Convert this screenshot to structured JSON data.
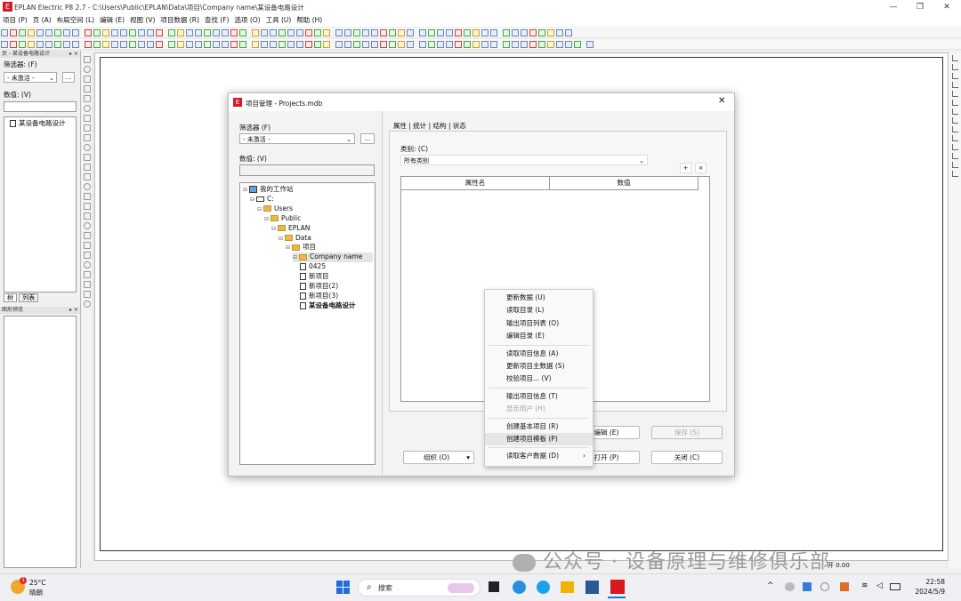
{
  "window": {
    "title": "EPLAN Electric P8 2.7 - C:\\Users\\Public\\EPLAN\\Data\\项目\\Company name\\某设备电路设计",
    "logo_text": "E",
    "min_glyph": "—",
    "restore_glyph": "❐",
    "close_glyph": "✕"
  },
  "menubar": [
    "项目 (P)",
    "页 (A)",
    "布局空间 (L)",
    "编辑 (E)",
    "视图 (V)",
    "项目数据 (R)",
    "查找 (F)",
    "选项 (O)",
    "工具 (U)",
    "帮助 (H)"
  ],
  "left_panel": {
    "header": "页 - 某设备电路设计",
    "pin": "▸ ×",
    "filter_label": "筛选器: (F)",
    "filter_value": "- 未激活 -",
    "filter_btn": "...",
    "value_label": "数值: (V)",
    "tree_item": "某设备电路设计",
    "tabs": [
      "树",
      "列表"
    ],
    "bottom_header": "图形预览",
    "bottom_pin": "▸ ×"
  },
  "dialog": {
    "title": "项目管理 - Projects.mdb",
    "logo_text": "E",
    "close_glyph": "✕",
    "filter_label": "筛选器 (F)",
    "filter_value": "- 未激活 -",
    "filter_btn": "...",
    "value_label": "数值: (V)",
    "tree": [
      {
        "text": "我的工作站",
        "level": 0,
        "type": "pc"
      },
      {
        "text": "C:",
        "level": 1,
        "type": "drive"
      },
      {
        "text": "Users",
        "level": 2,
        "type": "folder"
      },
      {
        "text": "Public",
        "level": 3,
        "type": "folder"
      },
      {
        "text": "EPLAN",
        "level": 4,
        "type": "folder"
      },
      {
        "text": "Data",
        "level": 5,
        "type": "folder"
      },
      {
        "text": "项目",
        "level": 6,
        "type": "folder"
      },
      {
        "text": "Company name",
        "level": 7,
        "type": "folder",
        "selected": true
      },
      {
        "text": "0425",
        "level": 8,
        "type": "project"
      },
      {
        "text": "新项目",
        "level": 8,
        "type": "project"
      },
      {
        "text": "新项目(2)",
        "level": 8,
        "type": "project"
      },
      {
        "text": "新项目(3)",
        "level": 8,
        "type": "project"
      },
      {
        "text": "某设备电路设计",
        "level": 8,
        "type": "project",
        "bold": true
      }
    ],
    "tabs": [
      "属性",
      "统计",
      "结构",
      "状态"
    ],
    "category_label": "类别: (C)",
    "category_value": "所有类别",
    "add_btn": "+",
    "del_btn": "×",
    "table_headers": [
      "属性名",
      "数值"
    ],
    "buttons": {
      "organize": "组织 (O)",
      "edit": "编辑 (E)",
      "save": "保存 (S)",
      "open": "打开 (P)",
      "close": "关闭 (C)"
    }
  },
  "context_menu": [
    {
      "label": "更新数据 (U)"
    },
    {
      "label": "读取目录 (L)"
    },
    {
      "label": "输出项目列表 (O)"
    },
    {
      "label": "编辑目录 (E)"
    },
    {
      "sep": true
    },
    {
      "label": "读取项目信息 (A)"
    },
    {
      "label": "更新项目主数据 (S)"
    },
    {
      "label": "校验项目... (V)"
    },
    {
      "sep": true
    },
    {
      "label": "输出项目信息 (T)"
    },
    {
      "label": "显示用户 (H)",
      "disabled": true
    },
    {
      "sep": true
    },
    {
      "label": "创建基本项目 (R)"
    },
    {
      "label": "创建项目模板 (P)",
      "highlighted": true
    },
    {
      "sep": true
    },
    {
      "label": "读取客户数据 (D)",
      "submenu": true
    }
  ],
  "status_bar": {
    "right_text": "开 0.00"
  },
  "taskbar": {
    "weather_temp": "25°C",
    "weather_desc": "晴朗",
    "weather_badge": "1",
    "search_placeholder": "搜索",
    "time": "22:58",
    "date": "2024/5/9",
    "tray_caret": "^"
  },
  "watermark": "公众号 · 设备原理与维修俱乐部"
}
